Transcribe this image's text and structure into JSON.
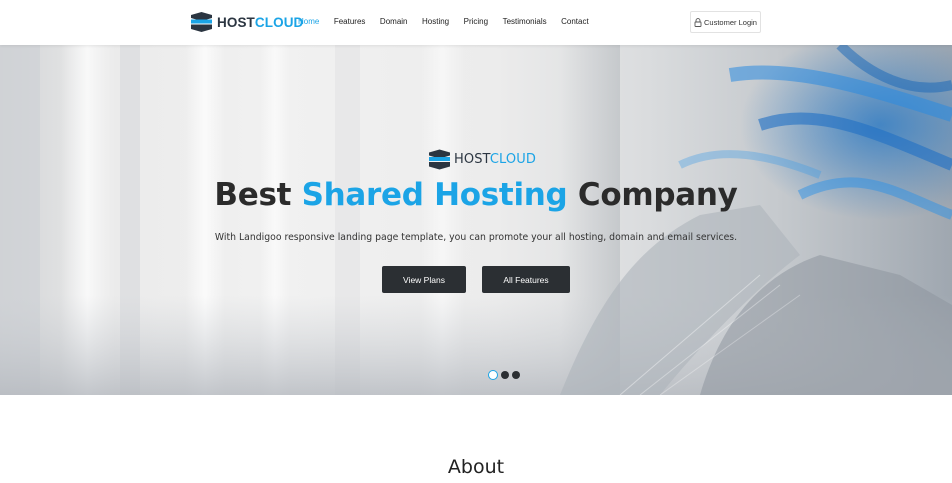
{
  "brand": {
    "host": "HOST",
    "cloud": "CLOUD",
    "accent_color": "#1ba4e6",
    "dark_color": "#2b3541"
  },
  "nav": {
    "items": [
      {
        "label": "Home",
        "active": true
      },
      {
        "label": "Features",
        "active": false
      },
      {
        "label": "Domain",
        "active": false
      },
      {
        "label": "Hosting",
        "active": false
      },
      {
        "label": "Pricing",
        "active": false
      },
      {
        "label": "Testimonials",
        "active": false
      },
      {
        "label": "Contact",
        "active": false
      }
    ],
    "login_label": "Customer Login",
    "login_icon": "lock-icon"
  },
  "hero": {
    "brand_host": "HOST",
    "brand_cloud": "CLOUD",
    "title_before": "Best ",
    "title_accent": "Shared Hosting",
    "title_after": " Company",
    "subtitle": "With Landigoo responsive landing page template, you can promote your all hosting, domain and email services.",
    "buttons": {
      "plans": "View Plans",
      "features": "All Features"
    },
    "slides": {
      "count": 3,
      "active_index": 0
    }
  },
  "about": {
    "heading": "About"
  }
}
